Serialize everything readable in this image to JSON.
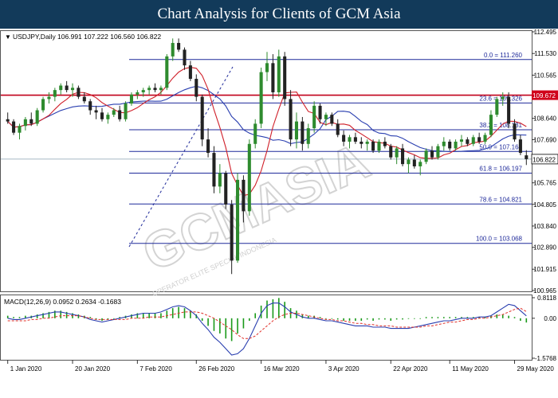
{
  "header": {
    "title": "Chart Analysis for Clients of GCM Asia"
  },
  "watermark": "GCMASIA",
  "watermark_sub": "OPERATOR ELITE SPECIAL INDONESIA",
  "colors": {
    "header_bg": "#123a5a",
    "up_candle": "#2e8b2e",
    "down_candle": "#222222",
    "ma_fast": "#d0202a",
    "ma_slow": "#2a3fb0",
    "fib_line": "#1f2a9a",
    "resistance_line": "#c0001a",
    "price_tag_red": "#d0021b",
    "price_tag_current": "#ffffff",
    "macd_hist": "#1a9a1a",
    "macd_line": "#2a3fb0",
    "macd_signal": "#e0302a"
  },
  "chart_data": [
    {
      "type": "candlestick",
      "info": "USDJPY,Daily  106.991 107.222 106.560 106.822",
      "ylim": [
        100.965,
        112.495
      ],
      "y_ticks": [
        112.495,
        111.53,
        110.565,
        109.6,
        108.64,
        107.69,
        106.73,
        105.765,
        104.805,
        103.84,
        102.89,
        101.915,
        100.965
      ],
      "x_ticks": [
        "1 Jan 2020",
        "20 Jan 2020",
        "7 Feb 2020",
        "26 Feb 2020",
        "16 Mar 2020",
        "3 Apr 2020",
        "22 Apr 2020",
        "11 May 2020",
        "29 May 2020"
      ],
      "fib_levels": [
        {
          "label": "0.0 = 111.260",
          "value": 111.26
        },
        {
          "label": "23.6 = 109.326",
          "value": 109.326
        },
        {
          "label": "38.2 = 108.131",
          "value": 108.131
        },
        {
          "label": "50.0 = 107.164",
          "value": 107.164
        },
        {
          "label": "61.8 = 106.197",
          "value": 106.197
        },
        {
          "label": "78.6 = 104.821",
          "value": 104.821
        },
        {
          "label": "100.0 = 103.068",
          "value": 103.068
        }
      ],
      "resistance": {
        "label": "109.672",
        "value": 109.672
      },
      "current_price": {
        "label": "106.822",
        "value": 106.822
      },
      "ohlc": [
        [
          108.6,
          108.9,
          108.4,
          108.5
        ],
        [
          108.5,
          108.6,
          107.9,
          108.0
        ],
        [
          108.0,
          108.4,
          107.7,
          108.3
        ],
        [
          108.3,
          108.7,
          108.1,
          108.6
        ],
        [
          108.6,
          108.9,
          108.3,
          108.4
        ],
        [
          108.4,
          109.1,
          108.3,
          109.0
        ],
        [
          109.0,
          109.6,
          108.9,
          109.5
        ],
        [
          109.5,
          109.8,
          109.3,
          109.6
        ],
        [
          109.6,
          110.0,
          109.4,
          109.9
        ],
        [
          109.9,
          110.2,
          109.7,
          110.1
        ],
        [
          110.1,
          110.3,
          109.8,
          109.9
        ],
        [
          109.9,
          110.2,
          109.6,
          110.0
        ],
        [
          110.0,
          110.1,
          109.5,
          109.6
        ],
        [
          109.6,
          109.8,
          109.3,
          109.4
        ],
        [
          109.4,
          109.5,
          108.8,
          109.0
        ],
        [
          109.0,
          109.2,
          108.6,
          108.9
        ],
        [
          108.9,
          109.1,
          108.5,
          108.6
        ],
        [
          108.6,
          108.9,
          108.4,
          108.8
        ],
        [
          108.8,
          109.1,
          108.7,
          109.0
        ],
        [
          109.0,
          109.2,
          108.5,
          108.6
        ],
        [
          108.6,
          109.4,
          108.5,
          109.3
        ],
        [
          109.3,
          109.8,
          109.2,
          109.7
        ],
        [
          109.7,
          109.9,
          109.5,
          109.8
        ],
        [
          109.8,
          110.0,
          109.6,
          109.9
        ],
        [
          109.9,
          110.1,
          109.7,
          110.0
        ],
        [
          110.0,
          110.2,
          109.8,
          109.9
        ],
        [
          109.9,
          110.1,
          109.7,
          110.0
        ],
        [
          110.0,
          111.5,
          109.9,
          111.4
        ],
        [
          111.4,
          112.2,
          111.2,
          112.0
        ],
        [
          112.0,
          112.2,
          111.6,
          111.7
        ],
        [
          111.7,
          111.8,
          110.8,
          111.0
        ],
        [
          111.0,
          111.2,
          110.3,
          110.4
        ],
        [
          110.4,
          110.6,
          109.4,
          109.6
        ],
        [
          109.6,
          109.7,
          107.4,
          107.7
        ],
        [
          107.7,
          108.2,
          106.9,
          107.1
        ],
        [
          107.1,
          107.4,
          105.3,
          105.6
        ],
        [
          105.6,
          106.6,
          105.3,
          106.2
        ],
        [
          106.2,
          106.3,
          104.6,
          104.8
        ],
        [
          104.8,
          105.0,
          101.7,
          102.3
        ],
        [
          102.3,
          106.2,
          102.2,
          105.9
        ],
        [
          105.9,
          106.1,
          104.0,
          104.5
        ],
        [
          104.5,
          107.7,
          104.3,
          107.5
        ],
        [
          107.5,
          108.6,
          107.3,
          108.4
        ],
        [
          108.4,
          110.9,
          108.2,
          110.7
        ],
        [
          110.7,
          111.6,
          110.3,
          111.1
        ],
        [
          111.1,
          111.5,
          109.5,
          109.8
        ],
        [
          109.8,
          111.7,
          109.6,
          111.4
        ],
        [
          111.4,
          111.6,
          109.2,
          109.5
        ],
        [
          109.5,
          109.9,
          107.4,
          107.7
        ],
        [
          107.7,
          108.9,
          107.3,
          108.5
        ],
        [
          108.5,
          108.7,
          107.2,
          107.5
        ],
        [
          107.5,
          108.4,
          107.3,
          108.2
        ],
        [
          108.2,
          109.4,
          108.0,
          109.2
        ],
        [
          109.2,
          109.3,
          108.4,
          108.6
        ],
        [
          108.6,
          108.9,
          108.3,
          108.8
        ],
        [
          108.8,
          108.9,
          108.3,
          108.4
        ],
        [
          108.4,
          108.6,
          107.8,
          107.9
        ],
        [
          107.9,
          108.1,
          107.4,
          107.6
        ],
        [
          107.6,
          107.9,
          107.3,
          107.8
        ],
        [
          107.8,
          108.0,
          107.5,
          107.6
        ],
        [
          107.6,
          107.8,
          107.3,
          107.5
        ],
        [
          107.5,
          107.7,
          107.2,
          107.6
        ],
        [
          107.6,
          107.7,
          107.1,
          107.2
        ],
        [
          107.2,
          107.7,
          107.1,
          107.6
        ],
        [
          107.6,
          107.8,
          107.3,
          107.4
        ],
        [
          107.4,
          107.5,
          106.8,
          106.9
        ],
        [
          106.9,
          107.4,
          106.6,
          107.3
        ],
        [
          107.3,
          107.5,
          106.5,
          106.6
        ],
        [
          106.6,
          106.9,
          106.2,
          106.8
        ],
        [
          106.8,
          107.0,
          106.4,
          106.5
        ],
        [
          106.5,
          106.8,
          106.1,
          106.7
        ],
        [
          106.7,
          107.3,
          106.6,
          107.2
        ],
        [
          107.2,
          107.4,
          106.8,
          106.9
        ],
        [
          106.9,
          107.5,
          106.8,
          107.4
        ],
        [
          107.4,
          107.8,
          107.2,
          107.6
        ],
        [
          107.6,
          107.7,
          107.2,
          107.3
        ],
        [
          107.3,
          107.7,
          107.2,
          107.6
        ],
        [
          107.6,
          107.9,
          107.4,
          107.7
        ],
        [
          107.7,
          107.8,
          107.4,
          107.5
        ],
        [
          107.5,
          107.9,
          107.4,
          107.8
        ],
        [
          107.8,
          108.0,
          107.5,
          107.6
        ],
        [
          107.6,
          108.0,
          107.5,
          107.9
        ],
        [
          107.9,
          109.0,
          107.8,
          108.8
        ],
        [
          108.8,
          109.6,
          108.7,
          109.5
        ],
        [
          109.5,
          109.8,
          109.2,
          109.6
        ],
        [
          109.6,
          109.8,
          108.2,
          108.4
        ],
        [
          108.4,
          108.6,
          107.6,
          107.7
        ],
        [
          107.7,
          107.9,
          107.0,
          107.1
        ],
        [
          106.991,
          107.222,
          106.56,
          106.822
        ]
      ]
    },
    {
      "type": "line",
      "info": "MACD(12,26,9) 0.0952 0.2634 -0.1683",
      "ylim": [
        -1.5768,
        0.8118
      ],
      "y_ticks": [
        0.8118,
        0.0,
        -1.5768
      ],
      "y_tick_labels": [
        "0.8118",
        "0.00",
        "-1.5768"
      ],
      "histogram": [
        0.1,
        0.05,
        0.05,
        0.1,
        0.1,
        0.15,
        0.2,
        0.25,
        0.3,
        0.3,
        0.25,
        0.2,
        0.15,
        0.1,
        0.05,
        -0.05,
        -0.1,
        -0.05,
        0.0,
        0.05,
        0.1,
        0.15,
        0.2,
        0.2,
        0.2,
        0.2,
        0.2,
        0.3,
        0.4,
        0.45,
        0.4,
        0.3,
        0.15,
        -0.1,
        -0.3,
        -0.5,
        -0.6,
        -0.8,
        -0.9,
        -0.6,
        -0.4,
        -0.1,
        0.2,
        0.5,
        0.7,
        0.75,
        0.8,
        0.65,
        0.4,
        0.3,
        0.15,
        0.1,
        0.1,
        0.05,
        0.0,
        0.0,
        -0.05,
        -0.1,
        -0.1,
        -0.1,
        -0.1,
        -0.05,
        -0.1,
        -0.05,
        -0.05,
        -0.1,
        -0.05,
        -0.05,
        0.0,
        0.0,
        0.0,
        0.05,
        0.05,
        0.05,
        0.05,
        0.05,
        0.05,
        0.05,
        0.05,
        0.05,
        0.05,
        0.05,
        0.1,
        0.15,
        0.15,
        0.1,
        0.05,
        -0.1,
        -0.168
      ],
      "macd_line": [
        0.0,
        -0.05,
        -0.05,
        0.0,
        0.05,
        0.1,
        0.15,
        0.2,
        0.25,
        0.25,
        0.2,
        0.15,
        0.1,
        0.05,
        -0.05,
        -0.1,
        -0.15,
        -0.1,
        -0.05,
        0.0,
        0.05,
        0.1,
        0.15,
        0.2,
        0.2,
        0.2,
        0.25,
        0.35,
        0.45,
        0.5,
        0.45,
        0.3,
        0.1,
        -0.2,
        -0.45,
        -0.75,
        -0.95,
        -1.2,
        -1.45,
        -1.4,
        -1.2,
        -0.8,
        -0.3,
        0.2,
        0.5,
        0.6,
        0.6,
        0.45,
        0.25,
        0.15,
        0.05,
        0.0,
        0.0,
        -0.05,
        -0.1,
        -0.1,
        -0.15,
        -0.2,
        -0.25,
        -0.3,
        -0.3,
        -0.3,
        -0.35,
        -0.35,
        -0.35,
        -0.4,
        -0.4,
        -0.4,
        -0.4,
        -0.35,
        -0.3,
        -0.25,
        -0.2,
        -0.15,
        -0.1,
        -0.1,
        -0.05,
        0.0,
        0.0,
        0.0,
        0.05,
        0.05,
        0.1,
        0.25,
        0.4,
        0.55,
        0.5,
        0.3,
        0.0952
      ],
      "signal_line": [
        -0.1,
        -0.1,
        -0.1,
        -0.1,
        -0.05,
        -0.05,
        0.0,
        0.0,
        0.05,
        0.1,
        0.1,
        0.1,
        0.1,
        0.05,
        0.0,
        -0.05,
        -0.05,
        -0.05,
        -0.05,
        -0.05,
        -0.05,
        0.0,
        0.0,
        0.0,
        0.05,
        0.05,
        0.05,
        0.1,
        0.15,
        0.2,
        0.25,
        0.25,
        0.25,
        0.2,
        0.1,
        0.0,
        -0.15,
        -0.3,
        -0.45,
        -0.65,
        -0.8,
        -0.8,
        -0.7,
        -0.5,
        -0.3,
        -0.1,
        0.05,
        0.15,
        0.2,
        0.2,
        0.15,
        0.1,
        0.05,
        0.0,
        -0.05,
        -0.05,
        -0.1,
        -0.1,
        -0.15,
        -0.2,
        -0.2,
        -0.25,
        -0.25,
        -0.3,
        -0.3,
        -0.3,
        -0.35,
        -0.35,
        -0.35,
        -0.35,
        -0.35,
        -0.3,
        -0.3,
        -0.25,
        -0.2,
        -0.15,
        -0.15,
        -0.1,
        -0.05,
        -0.05,
        0.0,
        0.0,
        0.05,
        0.1,
        0.15,
        0.25,
        0.35,
        0.4,
        0.2634
      ]
    }
  ]
}
